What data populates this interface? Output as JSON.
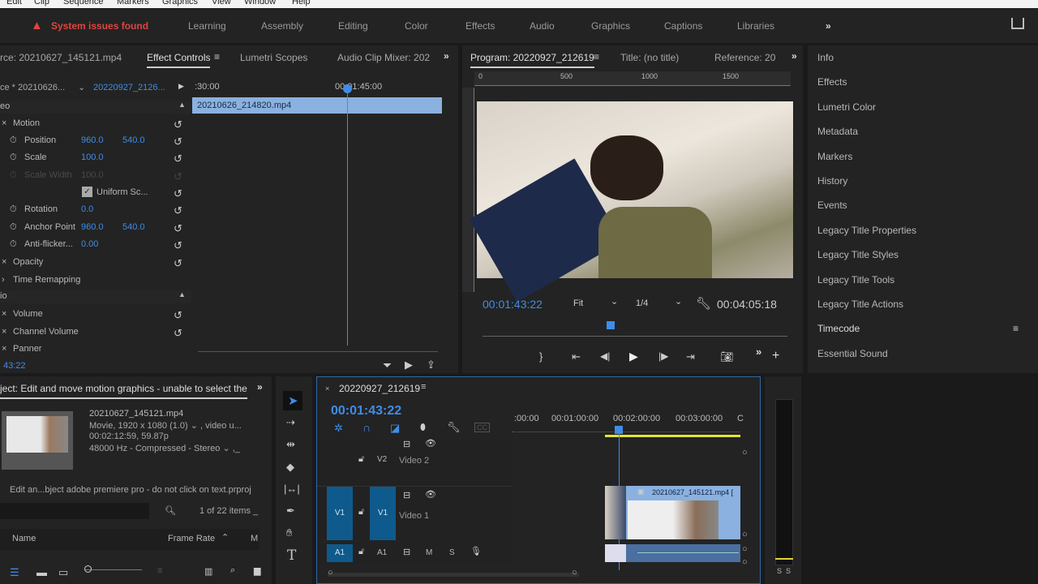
{
  "menu": [
    "Edit",
    "Clip",
    "Sequence",
    "Markers",
    "Graphics",
    "View",
    "Window",
    "Help"
  ],
  "header": {
    "warning": "System issues found",
    "workspaces": [
      "Learning",
      "Assembly",
      "Editing",
      "Color",
      "Effects",
      "Audio",
      "Graphics",
      "Captions",
      "Libraries"
    ],
    "more": "»"
  },
  "effect_panel": {
    "tabs": [
      "rce: 20210627_145121.mp4",
      "Effect Controls",
      "Lumetri Scopes",
      "Audio Clip Mixer: 202"
    ],
    "source_label": "ce * 20210626...",
    "sequence_label": "20220927_2126...",
    "ruler": [
      ":30:00",
      "00:01:45:00"
    ],
    "clip_name": "20210626_214820.mp4",
    "video_section": "eo",
    "audio_section": "io",
    "timecode": "43:22",
    "rows": [
      {
        "label": "Motion"
      },
      {
        "label": "Position",
        "v1": "960.0",
        "v2": "540.0"
      },
      {
        "label": "Scale",
        "v1": "100.0"
      },
      {
        "label": "Scale Width",
        "v1": "100.0"
      },
      {
        "label": "Uniform Sc..."
      },
      {
        "label": "Rotation",
        "v1": "0.0"
      },
      {
        "label": "Anchor Point",
        "v1": "960.0",
        "v2": "540.0"
      },
      {
        "label": "Anti-flicker...",
        "v1": "0.00"
      },
      {
        "label": "Opacity"
      },
      {
        "label": "Time Remapping"
      },
      {
        "label": "Volume"
      },
      {
        "label": "Channel Volume"
      },
      {
        "label": "Panner"
      }
    ]
  },
  "program": {
    "tabs": [
      "Program: 20220927_212619",
      "Title: (no title)",
      "Reference: 20"
    ],
    "ruler": [
      "0",
      "500",
      "1000",
      "1500"
    ],
    "timecode": "00:01:43:22",
    "fit": "Fit",
    "resolution": "1/4",
    "duration": "00:04:05:18",
    "playhead_fraction": 0.42
  },
  "right_panel": {
    "items": [
      "Info",
      "Effects",
      "Lumetri Color",
      "Metadata",
      "Markers",
      "History",
      "Events",
      "Legacy Title Properties",
      "Legacy Title Styles",
      "Legacy Title Tools",
      "Legacy Title Actions",
      "Timecode",
      "Essential Sound"
    ]
  },
  "project": {
    "tab": "ject: Edit and move motion graphics - unable to select the",
    "clip_name": "20210627_145121.mp4",
    "info1": "Movie, 1920 x 1080 (1.0) ⌄ , video u...",
    "info2": "00:02:12:59, 59.87p",
    "info3": "48000 Hz - Compressed - Stereo ⌄ ,_",
    "project_file": "Edit an...bject adobe premiere pro - do not click on text.prproj",
    "item_count": "1 of 22 items _",
    "col_name": "Name",
    "col_frame_rate": "Frame Rate",
    "col_m": "M"
  },
  "timeline": {
    "sequence": "20220927_212619",
    "timecode": "00:01:43:22",
    "ruler": [
      ":00:00",
      "00:01:00:00",
      "00:02:00:00",
      "00:03:00:00",
      "C"
    ],
    "tracks": {
      "v2": {
        "target": "V2",
        "name": "Video 2"
      },
      "v1": {
        "source": "V1",
        "target": "V1",
        "name": "Video 1"
      },
      "a1": {
        "source": "A1",
        "target": "A1",
        "m": "M",
        "s": "S"
      }
    },
    "clip_name": "20210627_145121.mp4 ["
  },
  "meter": {
    "labels": [
      "S",
      "S"
    ]
  }
}
